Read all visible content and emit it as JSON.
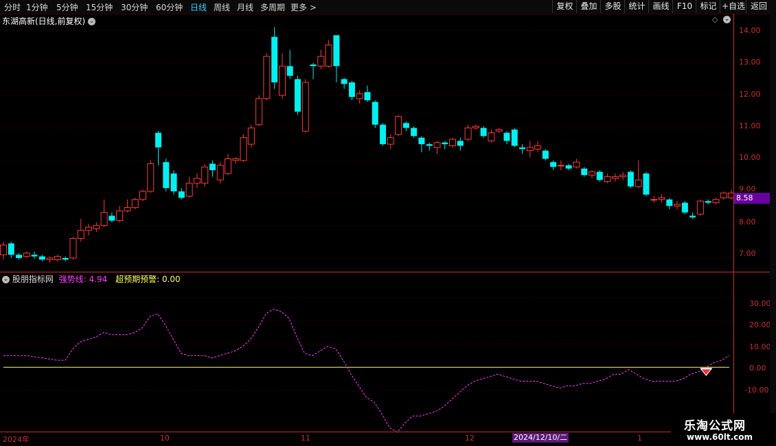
{
  "toolbar": {
    "periods": [
      "分时",
      "1分钟",
      "5分钟",
      "15分钟",
      "30分钟",
      "60分钟",
      "日线",
      "周线",
      "月线",
      "多周期",
      "更多"
    ],
    "active_period": "日线",
    "buttons": [
      "复权",
      "叠加",
      "多股",
      "统计",
      "画线",
      "F10",
      "标记",
      "+自选",
      "返回"
    ]
  },
  "main": {
    "title": "东湖高新(日线,前复权)",
    "price_ticks": [
      "14.00",
      "13.00",
      "12.00",
      "11.00",
      "10.00",
      "9.00",
      "8.00",
      "7.00"
    ],
    "current_price": "8.58"
  },
  "indicator": {
    "name": "股朋指标网",
    "line1_label": "强势线:",
    "line1_value": "4.94",
    "line2_label": "超预期预警:",
    "line2_value": "0.00",
    "ticks": [
      "30.00",
      "20.00",
      "10.00",
      "0.00",
      "-10.00"
    ]
  },
  "xaxis": {
    "labels": [
      "2024年",
      "10",
      "11",
      "12",
      "1"
    ],
    "cursor_date": "2024/12/10/二"
  },
  "watermark": {
    "title": "乐淘公式网",
    "url": "www.60lt.com"
  },
  "colors": {
    "up": "#ff3c3c",
    "down": "#00f0f0",
    "strong_line": "#ff40ff",
    "zero_line": "#ffff80",
    "axis": "#c83232",
    "active_tab": "#3dd0ff"
  },
  "chart_data": [
    {
      "type": "candlestick",
      "title": "东湖高新(日线,前复权)",
      "ylim": [
        6.6,
        14.3
      ],
      "candles": [
        {
          "o": 7.1,
          "c": 7.4,
          "h": 7.5,
          "l": 6.95
        },
        {
          "o": 7.45,
          "c": 7.1,
          "h": 7.5,
          "l": 7.0
        },
        {
          "o": 7.1,
          "c": 7.0,
          "h": 7.15,
          "l": 6.95
        },
        {
          "o": 7.05,
          "c": 7.15,
          "h": 7.2,
          "l": 7.0
        },
        {
          "o": 7.1,
          "c": 7.05,
          "h": 7.2,
          "l": 6.98
        },
        {
          "o": 7.05,
          "c": 6.95,
          "h": 7.1,
          "l": 6.9
        },
        {
          "o": 6.95,
          "c": 7.0,
          "h": 7.05,
          "l": 6.85
        },
        {
          "o": 6.95,
          "c": 7.05,
          "h": 7.1,
          "l": 6.9
        },
        {
          "o": 7.0,
          "c": 6.95,
          "h": 7.05,
          "l": 6.9
        },
        {
          "o": 7.0,
          "c": 7.6,
          "h": 7.65,
          "l": 6.95
        },
        {
          "o": 7.6,
          "c": 7.85,
          "h": 8.2,
          "l": 7.5
        },
        {
          "o": 7.85,
          "c": 7.95,
          "h": 8.05,
          "l": 7.7
        },
        {
          "o": 7.9,
          "c": 8.0,
          "h": 8.1,
          "l": 7.8
        },
        {
          "o": 8.0,
          "c": 8.4,
          "h": 8.8,
          "l": 7.95
        },
        {
          "o": 8.3,
          "c": 8.15,
          "h": 8.4,
          "l": 8.1
        },
        {
          "o": 8.15,
          "c": 8.45,
          "h": 8.6,
          "l": 8.1
        },
        {
          "o": 8.45,
          "c": 8.55,
          "h": 8.8,
          "l": 8.4
        },
        {
          "o": 8.55,
          "c": 8.8,
          "h": 8.85,
          "l": 8.5
        },
        {
          "o": 8.8,
          "c": 9.05,
          "h": 9.1,
          "l": 8.75
        },
        {
          "o": 9.05,
          "c": 9.9,
          "h": 10.0,
          "l": 9.0
        },
        {
          "o": 10.85,
          "c": 10.4,
          "h": 10.9,
          "l": 9.85
        },
        {
          "o": 9.95,
          "c": 9.15,
          "h": 10.05,
          "l": 9.05
        },
        {
          "o": 9.6,
          "c": 9.05,
          "h": 9.7,
          "l": 8.95
        },
        {
          "o": 9.05,
          "c": 8.85,
          "h": 9.15,
          "l": 8.8
        },
        {
          "o": 8.9,
          "c": 9.3,
          "h": 9.5,
          "l": 8.85
        },
        {
          "o": 9.3,
          "c": 9.45,
          "h": 9.6,
          "l": 9.15
        },
        {
          "o": 9.3,
          "c": 9.8,
          "h": 9.9,
          "l": 9.2
        },
        {
          "o": 9.9,
          "c": 9.7,
          "h": 10.0,
          "l": 9.5
        },
        {
          "o": 9.4,
          "c": 9.85,
          "h": 9.95,
          "l": 9.3
        },
        {
          "o": 9.6,
          "c": 10.05,
          "h": 10.2,
          "l": 9.55
        },
        {
          "o": 10.0,
          "c": 10.05,
          "h": 10.1,
          "l": 9.9
        },
        {
          "o": 10.0,
          "c": 10.7,
          "h": 10.8,
          "l": 9.95
        },
        {
          "o": 10.5,
          "c": 11.0,
          "h": 11.1,
          "l": 10.4
        },
        {
          "o": 11.1,
          "c": 11.9,
          "h": 12.0,
          "l": 11.05
        },
        {
          "o": 11.9,
          "c": 13.2,
          "h": 13.3,
          "l": 11.85
        },
        {
          "o": 13.8,
          "c": 12.4,
          "h": 14.1,
          "l": 12.2
        },
        {
          "o": 12.0,
          "c": 12.9,
          "h": 13.3,
          "l": 11.9
        },
        {
          "o": 12.9,
          "c": 12.6,
          "h": 13.4,
          "l": 12.5
        },
        {
          "o": 12.5,
          "c": 11.5,
          "h": 12.6,
          "l": 11.4
        },
        {
          "o": 10.9,
          "c": 12.4,
          "h": 12.5,
          "l": 10.85
        },
        {
          "o": 12.95,
          "c": 12.9,
          "h": 13.0,
          "l": 12.5
        },
        {
          "o": 12.9,
          "c": 13.2,
          "h": 13.4,
          "l": 12.8
        },
        {
          "o": 12.9,
          "c": 13.55,
          "h": 13.7,
          "l": 12.85
        },
        {
          "o": 13.85,
          "c": 12.9,
          "h": 13.85,
          "l": 12.4
        },
        {
          "o": 12.5,
          "c": 12.35,
          "h": 12.55,
          "l": 12.2
        },
        {
          "o": 12.4,
          "c": 11.95,
          "h": 12.45,
          "l": 11.85
        },
        {
          "o": 11.9,
          "c": 12.05,
          "h": 12.15,
          "l": 11.75
        },
        {
          "o": 12.1,
          "c": 11.85,
          "h": 12.3,
          "l": 11.8
        },
        {
          "o": 11.8,
          "c": 11.1,
          "h": 11.85,
          "l": 11.0
        },
        {
          "o": 11.1,
          "c": 10.5,
          "h": 11.15,
          "l": 10.45
        },
        {
          "o": 10.5,
          "c": 10.7,
          "h": 10.8,
          "l": 10.35
        },
        {
          "o": 10.8,
          "c": 11.35,
          "h": 11.4,
          "l": 10.75
        },
        {
          "o": 11.15,
          "c": 11.0,
          "h": 11.2,
          "l": 10.9
        },
        {
          "o": 11.0,
          "c": 10.75,
          "h": 11.05,
          "l": 10.7
        },
        {
          "o": 10.7,
          "c": 10.5,
          "h": 10.75,
          "l": 10.25
        },
        {
          "o": 10.5,
          "c": 10.45,
          "h": 10.55,
          "l": 10.3
        },
        {
          "o": 10.4,
          "c": 10.55,
          "h": 10.6,
          "l": 10.2
        },
        {
          "o": 10.55,
          "c": 10.5,
          "h": 10.6,
          "l": 10.35
        },
        {
          "o": 10.45,
          "c": 10.65,
          "h": 10.7,
          "l": 10.4
        },
        {
          "o": 10.6,
          "c": 10.45,
          "h": 10.7,
          "l": 10.3
        },
        {
          "o": 10.65,
          "c": 11.0,
          "h": 11.1,
          "l": 10.6
        },
        {
          "o": 11.0,
          "c": 11.05,
          "h": 11.1,
          "l": 10.95
        },
        {
          "o": 11.0,
          "c": 10.75,
          "h": 11.05,
          "l": 10.7
        },
        {
          "o": 10.6,
          "c": 10.85,
          "h": 10.95,
          "l": 10.55
        },
        {
          "o": 10.9,
          "c": 10.95,
          "h": 11.0,
          "l": 10.85
        },
        {
          "o": 10.85,
          "c": 10.6,
          "h": 10.9,
          "l": 10.5
        },
        {
          "o": 10.95,
          "c": 10.45,
          "h": 11.0,
          "l": 10.4
        },
        {
          "o": 10.4,
          "c": 10.35,
          "h": 10.5,
          "l": 10.2
        },
        {
          "o": 10.3,
          "c": 10.4,
          "h": 10.6,
          "l": 10.1
        },
        {
          "o": 10.35,
          "c": 10.45,
          "h": 10.6,
          "l": 10.25
        },
        {
          "o": 10.3,
          "c": 10.05,
          "h": 10.35,
          "l": 10.0
        },
        {
          "o": 9.95,
          "c": 9.8,
          "h": 10.0,
          "l": 9.7
        },
        {
          "o": 9.85,
          "c": 9.85,
          "h": 10.0,
          "l": 9.7
        },
        {
          "o": 9.85,
          "c": 9.75,
          "h": 9.9,
          "l": 9.7
        },
        {
          "o": 9.8,
          "c": 9.95,
          "h": 10.05,
          "l": 9.75
        },
        {
          "o": 9.75,
          "c": 9.55,
          "h": 9.8,
          "l": 9.5
        },
        {
          "o": 9.55,
          "c": 9.65,
          "h": 9.7,
          "l": 9.45
        },
        {
          "o": 9.65,
          "c": 9.4,
          "h": 9.7,
          "l": 9.35
        },
        {
          "o": 9.35,
          "c": 9.5,
          "h": 9.6,
          "l": 9.3
        },
        {
          "o": 9.45,
          "c": 9.5,
          "h": 9.6,
          "l": 9.35
        },
        {
          "o": 9.5,
          "c": 9.55,
          "h": 9.65,
          "l": 9.4
        },
        {
          "o": 9.65,
          "c": 9.2,
          "h": 9.7,
          "l": 9.15
        },
        {
          "o": 9.2,
          "c": 9.4,
          "h": 10.0,
          "l": 9.15
        },
        {
          "o": 9.6,
          "c": 8.95,
          "h": 9.65,
          "l": 8.9
        },
        {
          "o": 8.8,
          "c": 8.8,
          "h": 8.9,
          "l": 8.7
        },
        {
          "o": 8.8,
          "c": 8.85,
          "h": 8.95,
          "l": 8.7
        },
        {
          "o": 8.8,
          "c": 8.6,
          "h": 8.85,
          "l": 8.5
        },
        {
          "o": 8.6,
          "c": 8.65,
          "h": 8.75,
          "l": 8.5
        },
        {
          "o": 8.7,
          "c": 8.4,
          "h": 8.75,
          "l": 8.35
        },
        {
          "o": 8.3,
          "c": 8.25,
          "h": 8.4,
          "l": 8.2
        },
        {
          "o": 8.35,
          "c": 8.75,
          "h": 8.8,
          "l": 8.3
        },
        {
          "o": 8.75,
          "c": 8.7,
          "h": 8.8,
          "l": 8.65
        },
        {
          "o": 8.7,
          "c": 8.8,
          "h": 8.85,
          "l": 8.65
        },
        {
          "o": 8.85,
          "c": 9.0,
          "h": 9.05,
          "l": 8.8
        },
        {
          "o": 8.85,
          "c": 9.0,
          "h": 9.1,
          "l": 8.8
        }
      ]
    },
    {
      "type": "line",
      "title": "股朋指标网",
      "ylim": [
        -28,
        37
      ],
      "series": [
        {
          "name": "强势线",
          "values": [
            5,
            5,
            5,
            5,
            4.5,
            4,
            3.5,
            3,
            3,
            8,
            11,
            12,
            13,
            15,
            14,
            14,
            14,
            15,
            17,
            22,
            23,
            18,
            12,
            6,
            5,
            5,
            5,
            4,
            5,
            6,
            7,
            9,
            12,
            17,
            23,
            25,
            24,
            21,
            13,
            6,
            5,
            7,
            9,
            8,
            3,
            -3,
            -8,
            -13,
            -15,
            -20,
            -26,
            -28,
            -24,
            -21,
            -21,
            -20,
            -19,
            -17,
            -14,
            -11,
            -8,
            -6,
            -5,
            -4,
            -3,
            -4,
            -5,
            -6,
            -6,
            -6,
            -7,
            -8,
            -9,
            -8,
            -8,
            -7,
            -7,
            -6,
            -5,
            -3,
            -3,
            -1,
            -3,
            -5,
            -6,
            -6,
            -6,
            -6,
            -5,
            -3,
            -2,
            0,
            2,
            3,
            5
          ]
        },
        {
          "name": "超预期预警",
          "values": [
            0,
            0,
            0
          ]
        }
      ]
    }
  ]
}
